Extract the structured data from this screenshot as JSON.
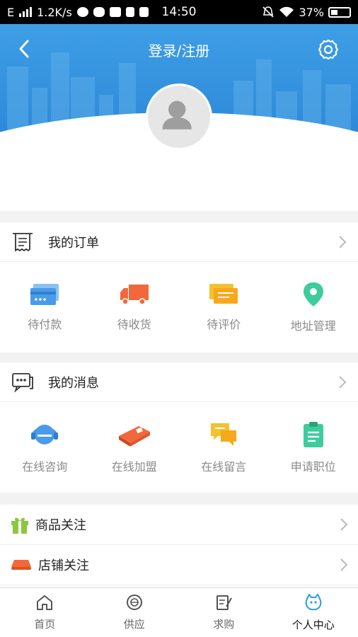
{
  "status_bar": {
    "network": "E",
    "speed": "1.2K/s",
    "time": "14:50",
    "battery": "37%"
  },
  "header": {
    "title": "登录/注册"
  },
  "orders": {
    "title": "我的订单",
    "items": [
      {
        "label": "待付款",
        "icon": "card-icon",
        "color": "#4a9be8"
      },
      {
        "label": "待收货",
        "icon": "truck-icon",
        "color": "#f2683a"
      },
      {
        "label": "待评价",
        "icon": "comment-icon",
        "color": "#f5c12e"
      },
      {
        "label": "地址管理",
        "icon": "location-pin-icon",
        "color": "#3dcc9c"
      }
    ]
  },
  "messages": {
    "title": "我的消息",
    "items": [
      {
        "label": "在线咨询",
        "icon": "headset-icon",
        "color": "#4a9be8"
      },
      {
        "label": "在线加盟",
        "icon": "franchise-icon",
        "color": "#f2683a"
      },
      {
        "label": "在线留言",
        "icon": "chat-bubbles-icon",
        "color": "#f5c12e"
      },
      {
        "label": "申请职位",
        "icon": "clipboard-icon",
        "color": "#3dcc9c"
      }
    ]
  },
  "follows": [
    {
      "label": "商品关注",
      "icon": "gift-icon",
      "color": "#8dc63f"
    },
    {
      "label": "店铺关注",
      "icon": "store-awning-icon",
      "color": "#f2683a"
    }
  ],
  "tabbar": {
    "tabs": [
      {
        "label": "首页",
        "icon": "home-icon",
        "active": false
      },
      {
        "label": "供应",
        "icon": "supply-icon",
        "active": false
      },
      {
        "label": "求购",
        "icon": "purchase-icon",
        "active": false
      },
      {
        "label": "个人中心",
        "icon": "profile-icon",
        "active": true
      }
    ]
  }
}
